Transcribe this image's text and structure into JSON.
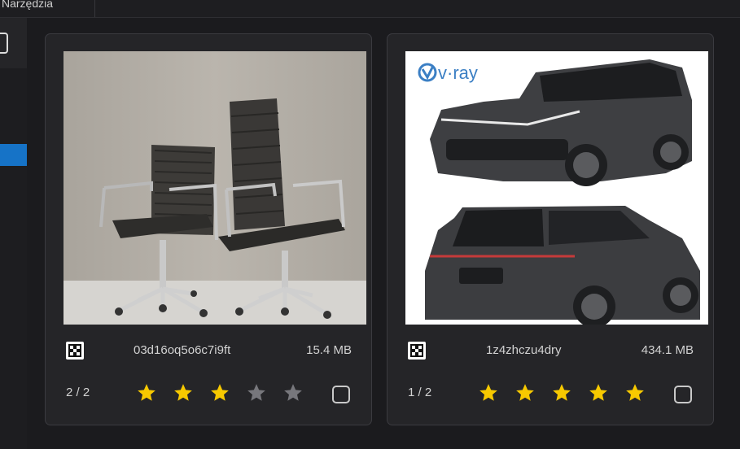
{
  "menu": {
    "label": "Narzędzia"
  },
  "colors": {
    "star_on": "#f7c900",
    "star_off": "#77777c",
    "accent": "#1673c7"
  },
  "cards": [
    {
      "filename": "03d16oq5o6c7i9ft",
      "size": "15.4 MB",
      "pager": "2 / 2",
      "rating": 3,
      "max_rating": 5,
      "subject": "office chairs"
    },
    {
      "filename": "1z4zhczu4dry",
      "size": "434.1 MB",
      "pager": "1 / 2",
      "rating": 5,
      "max_rating": 5,
      "subject": "suv renders",
      "watermark": "v·ray"
    }
  ]
}
